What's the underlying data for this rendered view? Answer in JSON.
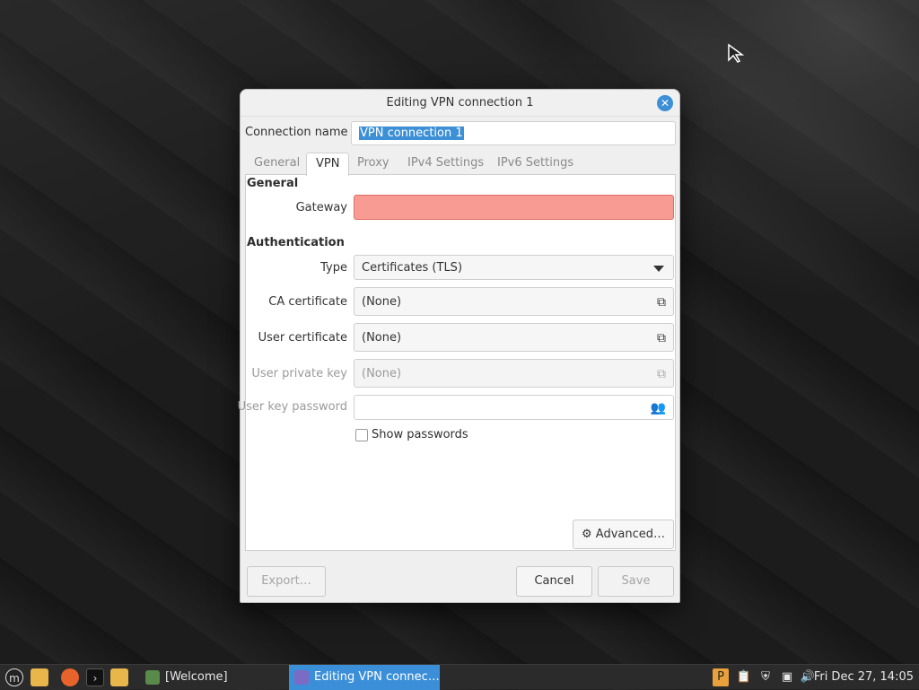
{
  "dialog": {
    "title": "Editing VPN connection 1",
    "close_icon": "close-icon",
    "connection_name_label": "Connection name",
    "connection_name_value": "VPN connection 1",
    "tabs": [
      {
        "label": "General",
        "active": false
      },
      {
        "label": "VPN",
        "active": true
      },
      {
        "label": "Proxy",
        "active": false
      },
      {
        "label": "IPv4 Settings",
        "active": false
      },
      {
        "label": "IPv6 Settings",
        "active": false
      }
    ],
    "general_section": "General",
    "gateway_label": "Gateway",
    "gateway_value": "",
    "gateway_error_color": "#f89c93",
    "auth_section": "Authentication",
    "type_label": "Type",
    "type_value": "Certificates (TLS)",
    "ca_cert_label": "CA certificate",
    "ca_cert_value": "(None)",
    "user_cert_label": "User certificate",
    "user_cert_value": "(None)",
    "user_key_label": "User private key",
    "user_key_value": "(None)",
    "user_key_password_label": "User key password",
    "user_key_password_value": "",
    "show_passwords_label": "Show passwords",
    "show_passwords_checked": false,
    "advanced_label": "Advanced…",
    "export_label": "Export…",
    "cancel_label": "Cancel",
    "save_label": "Save"
  },
  "taskbar": {
    "launchers": [
      "mint-menu-icon",
      "files-icon",
      "firefox-icon",
      "terminal-icon",
      "folder-icon"
    ],
    "windows": [
      {
        "label": "[Welcome]",
        "active": false
      },
      {
        "label": "Editing VPN connec…",
        "active": true
      }
    ],
    "tray": [
      "pamac-icon",
      "clipboard-icon",
      "shield-icon",
      "network-icon",
      "volume-icon"
    ],
    "clock": "Fri Dec 27, 14:05"
  },
  "colors": {
    "accent": "#3b8fd8",
    "taskbar_bg": "#2b2b2b"
  }
}
